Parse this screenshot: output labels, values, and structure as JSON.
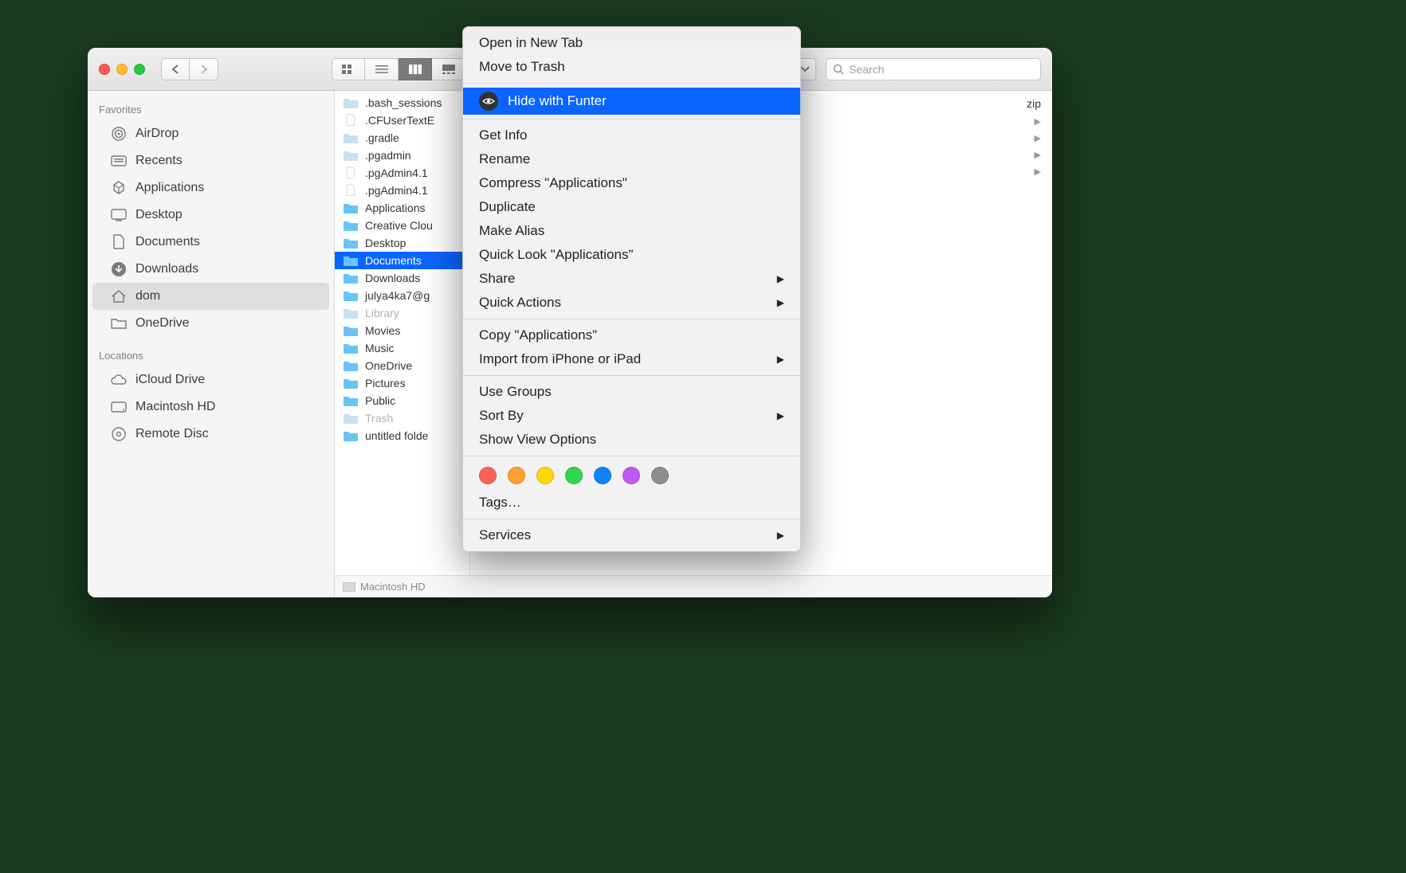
{
  "search_placeholder": "Search",
  "sidebar": {
    "section1": "Favorites",
    "section2": "Locations",
    "items": [
      {
        "label": "AirDrop"
      },
      {
        "label": "Recents"
      },
      {
        "label": "Applications"
      },
      {
        "label": "Desktop"
      },
      {
        "label": "Documents"
      },
      {
        "label": "Downloads"
      },
      {
        "label": "dom"
      },
      {
        "label": "OneDrive"
      }
    ],
    "locations": [
      {
        "label": "iCloud Drive"
      },
      {
        "label": "Macintosh HD"
      },
      {
        "label": "Remote Disc"
      }
    ]
  },
  "column": {
    "items": [
      {
        "label": ".bash_sessions",
        "type": "folder-dim"
      },
      {
        "label": ".CFUserTextE",
        "type": "doc"
      },
      {
        "label": ".gradle",
        "type": "folder-dim"
      },
      {
        "label": ".pgadmin",
        "type": "folder-dim"
      },
      {
        "label": ".pgAdmin4.1",
        "type": "doc"
      },
      {
        "label": ".pgAdmin4.1",
        "type": "doc"
      },
      {
        "label": "Applications",
        "type": "folder"
      },
      {
        "label": "Creative Clou",
        "type": "folder"
      },
      {
        "label": "Desktop",
        "type": "folder"
      },
      {
        "label": "Documents",
        "type": "folder",
        "selected": true
      },
      {
        "label": "Downloads",
        "type": "folder"
      },
      {
        "label": "julya4ka7@g",
        "type": "folder"
      },
      {
        "label": "Library",
        "type": "folder-dim",
        "dim": true
      },
      {
        "label": "Movies",
        "type": "folder"
      },
      {
        "label": "Music",
        "type": "folder"
      },
      {
        "label": "OneDrive",
        "type": "folder"
      },
      {
        "label": "Pictures",
        "type": "folder"
      },
      {
        "label": "Public",
        "type": "folder"
      },
      {
        "label": "Trash",
        "type": "folder-dim",
        "dim": true
      },
      {
        "label": "untitled folde",
        "type": "folder"
      }
    ],
    "pathbar": "Macintosh HD"
  },
  "right_fragment": "zip",
  "context_menu": {
    "items": [
      {
        "label": "Open in New Tab"
      },
      {
        "label": "Move to Trash"
      },
      {
        "sep": true
      },
      {
        "label": "Hide with Funter",
        "highlight": true,
        "icon": "funter"
      },
      {
        "sep": true
      },
      {
        "label": "Get Info"
      },
      {
        "label": "Rename"
      },
      {
        "label": "Compress \"Applications\""
      },
      {
        "label": "Duplicate"
      },
      {
        "label": "Make Alias"
      },
      {
        "label": "Quick Look \"Applications\""
      },
      {
        "label": "Share",
        "submenu": true
      },
      {
        "label": "Quick Actions",
        "submenu": true
      },
      {
        "sep": true
      },
      {
        "label": "Copy \"Applications\""
      },
      {
        "label": "Import from iPhone or iPad",
        "submenu": true
      },
      {
        "sep": true
      },
      {
        "label": "Use Groups"
      },
      {
        "label": "Sort By",
        "submenu": true
      },
      {
        "label": "Show View Options"
      },
      {
        "sep": true
      },
      {
        "tags": [
          "#ff5f57",
          "#ffa030",
          "#ffd60a",
          "#32d74b",
          "#0a84ff",
          "#bf5af2",
          "#8e8e93"
        ]
      },
      {
        "label": "Tags…"
      },
      {
        "sep": true
      },
      {
        "label": "Services",
        "submenu": true
      }
    ]
  }
}
